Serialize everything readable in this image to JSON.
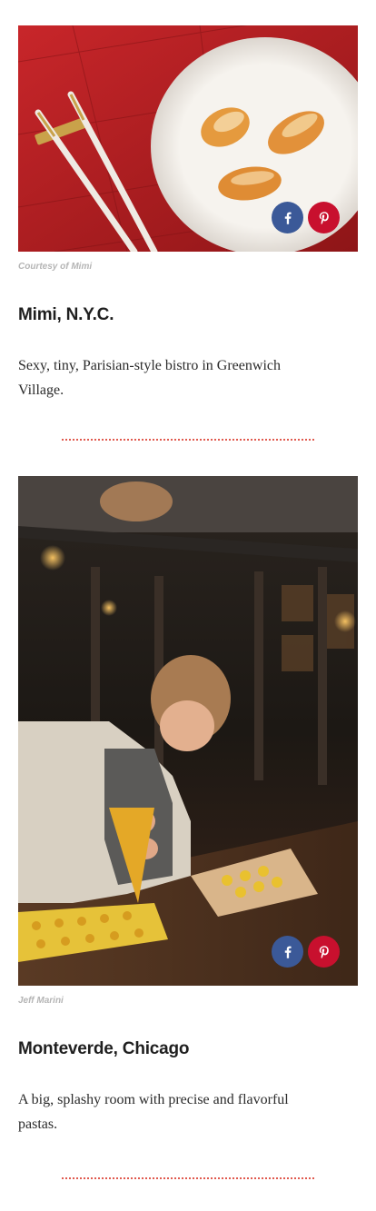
{
  "entries": [
    {
      "credit": "Courtesy of Mimi",
      "title": "Mimi, N.Y.C.",
      "description": "Sexy, tiny, Parisian-style bistro in Greenwich Village.",
      "image_subject": "three pieces of fish on a white plate on a red wooden table with white chopsticks"
    },
    {
      "credit": "Jeff Marini",
      "title": "Monteverde, Chicago",
      "description": "A big, splashy room with precise and flavorful pastas.",
      "image_subject": "chef piping yellow filling onto pasta sheets in a dim restaurant kitchen"
    }
  ],
  "share": {
    "facebook_icon": "facebook-icon",
    "pinterest_icon": "pinterest-icon",
    "facebook_color": "#3b5998",
    "pinterest_color": "#c8102e"
  },
  "colors": {
    "divider": "#e05a4f",
    "credit_text": "#b5b5b5",
    "title_text": "#1f1f1f"
  }
}
